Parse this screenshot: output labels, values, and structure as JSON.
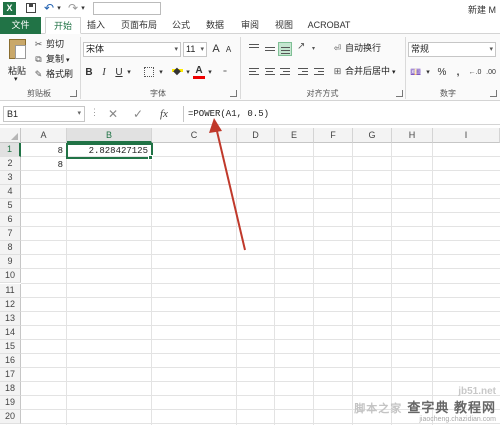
{
  "window": {
    "title_right": "新建 M",
    "app_icon_label": "X"
  },
  "ribbon_tabs": [
    "文件",
    "开始",
    "插入",
    "页面布局",
    "公式",
    "数据",
    "审阅",
    "视图",
    "ACROBAT"
  ],
  "clipboard": {
    "paste_label": "粘贴",
    "cut_label": "剪切",
    "copy_label": "复制",
    "format_painter_label": "格式刷",
    "group_label": "剪贴板"
  },
  "font": {
    "font_name": "宋体",
    "font_size": "11",
    "bold_label": "B",
    "italic_label": "I",
    "underline_label": "U",
    "color_label": "A",
    "group_label": "字体",
    "grow_label": "A",
    "shrink_label": "A"
  },
  "alignment": {
    "wrap_text_label": "自动换行",
    "merge_center_label": "合并后居中",
    "group_label": "对齐方式"
  },
  "number": {
    "format": "常规",
    "percent_label": "%",
    "comma_label": ",",
    "group_label": "数字"
  },
  "formula_bar": {
    "name_box": "B1",
    "formula": "=POWER(A1, 0.5)",
    "cancel_label": "✕",
    "enter_label": "✓",
    "fx_label": "fx"
  },
  "columns": [
    "A",
    "B",
    "C",
    "D",
    "E",
    "F",
    "G",
    "H",
    "I"
  ],
  "rows": [
    "1",
    "2",
    "3",
    "4",
    "5",
    "6",
    "7",
    "8",
    "9",
    "10",
    "11",
    "12",
    "13",
    "14",
    "15",
    "16",
    "17",
    "18",
    "19",
    "20"
  ],
  "cells": {
    "A1": "8",
    "A2": "8",
    "B1": "2.828427125"
  },
  "selection": {
    "cell": "B1",
    "column": "B",
    "row": "1"
  },
  "watermark": {
    "domain": "jb51.net",
    "main": "脚本之家",
    "sub": "查字典 教程网",
    "url": "jiaocheng.chazidian.com"
  },
  "colors": {
    "excel_green": "#217346",
    "arrow": "#c0392b"
  }
}
